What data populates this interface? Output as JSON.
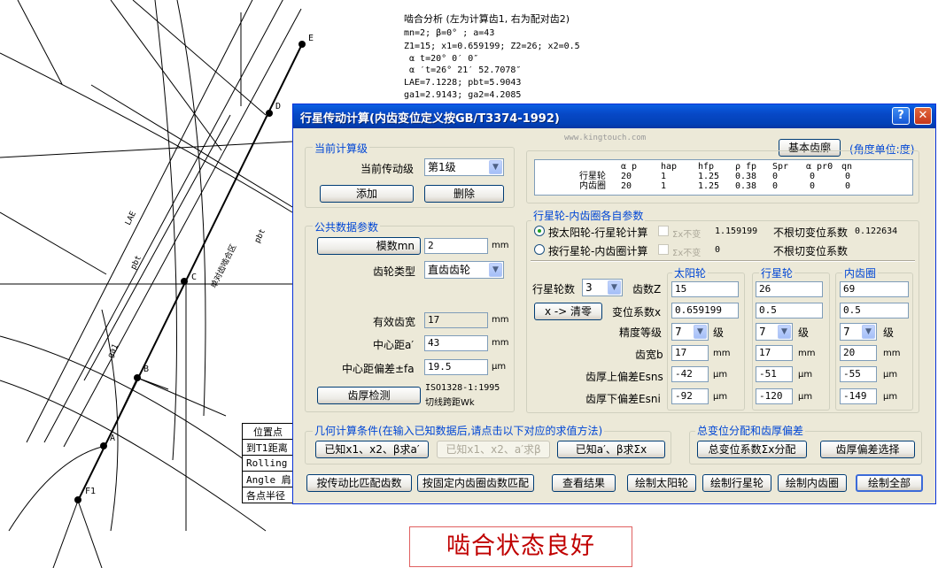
{
  "analysis": {
    "heading": "啮合分析 (左为计算齿1, 右为配对齿2)",
    "lines": [
      "mn=2; β=0° ; a=43",
      "Z1=15; x1=0.659199; Z2=26; x2=0.5",
      " α t=20° 0′ 0″",
      " α ′t=26° 21′ 52.7078″",
      "LAE=7.1228; pbt=5.9043",
      "ga1=2.9143; ga2=4.2085"
    ]
  },
  "drawing": {
    "points": [
      "E",
      "D",
      "C",
      "B",
      "A",
      "F1"
    ],
    "labels": {
      "lae": "LAE",
      "pbt1": "pbt",
      "pbt2": "pbt",
      "ga1": "ga1",
      "single": "单对齿啮合区"
    }
  },
  "position_table": {
    "rows": [
      "位置点",
      "到T1距离",
      "Rolling r",
      "Angle  肩",
      "各点半径"
    ]
  },
  "mesh_status": "啮合状态良好",
  "window": {
    "title": "行星传动计算(内齿变位定义按GB/T3374-1992)",
    "watermark": "www.kingtouch.com",
    "help": "?",
    "close": "✕",
    "current_group": {
      "title": "当前计算级",
      "stage_label": "当前传动级",
      "stage_value": "第1级",
      "add": "添加",
      "delete": "删除"
    },
    "basic_rack": {
      "button": "基本齿廓",
      "unit": "(角度单位:度)"
    },
    "param_table": {
      "headers": [
        "α p",
        "hap",
        "hfp",
        "ρ fp",
        "Spr",
        "α pr0",
        "qn"
      ],
      "rows": [
        {
          "name": "行星轮",
          "values": [
            "20",
            "1",
            "1.25",
            "0.38",
            "0",
            "0",
            "0"
          ]
        },
        {
          "name": "内齿圈",
          "values": [
            "20",
            "1",
            "1.25",
            "0.38",
            "0",
            "0",
            "0"
          ]
        }
      ]
    },
    "common_group": {
      "title": "公共数据参数",
      "module_button": "模数mn",
      "module_value": "2",
      "mm": "mm",
      "gear_type_label": "齿轮类型",
      "gear_type_value": "直齿齿轮",
      "eff_width_label": "有效齿宽",
      "eff_width_value": "17",
      "center_label": "中心距a′",
      "center_value": "43",
      "center_dev_label": "中心距偏差±fa",
      "center_dev_value": "19.5",
      "um": "μm",
      "thickness_button": "齿厚检测",
      "thickness_note1": "ISO1328-1:1995",
      "thickness_note2": "切线跨距Wk"
    },
    "planet_group": {
      "title": "行星轮-内齿圈各自参数",
      "opt1": "按太阳轮-行星轮计算",
      "opt2": "按行星轮-内齿圈计算",
      "sum_fixed": "Σx不变",
      "sum1_value": "1.159199",
      "sum2_value": "0",
      "noundercut1_label": "不根切变位系数",
      "noundercut1_value": "0.122634",
      "noundercut2_label": "不根切变位系数",
      "col_sun": "太阳轮",
      "col_planet": "行星轮",
      "col_ring": "内齿圈",
      "count_label": "行星轮数",
      "count_value": "3",
      "teeth_label": "齿数Z",
      "clear_button": "x -> 清零",
      "shift_label": "变位系数x",
      "grade_label": "精度等级",
      "grade_unit": "级",
      "width_label": "齿宽b",
      "upper_label": "齿厚上偏差Esns",
      "lower_label": "齿厚下偏差Esni",
      "mm": "mm",
      "um": "μm",
      "sun": {
        "z": "15",
        "x": "0.659199",
        "grade": "7",
        "b": "17",
        "esns": "-42",
        "esni": "-92"
      },
      "planet": {
        "z": "26",
        "x": "0.5",
        "grade": "7",
        "b": "17",
        "esns": "-51",
        "esni": "-120"
      },
      "ring": {
        "z": "69",
        "x": "0.5",
        "grade": "7",
        "b": "20",
        "esns": "-55",
        "esni": "-149"
      }
    },
    "geom_group": {
      "title": "几何计算条件(在输入已知数据后,请点击以下对应的求值方法)",
      "btn1": "已知x1、x2、β求a′",
      "btn2": "已知x1、x2、a′求β",
      "btn3": "已知a′、β求Σx"
    },
    "shift_group": {
      "title": "总变位分配和齿厚偏差",
      "btn1": "总变位系数Σx分配",
      "btn2": "齿厚偏差选择"
    },
    "bottom": {
      "ratio": "按传动比匹配齿数",
      "ring_match": "按固定内齿圈齿数匹配",
      "view": "查看结果",
      "draw_sun": "绘制太阳轮",
      "draw_planet": "绘制行星轮",
      "draw_ring": "绘制内齿圈",
      "draw_all": "绘制全部"
    }
  }
}
